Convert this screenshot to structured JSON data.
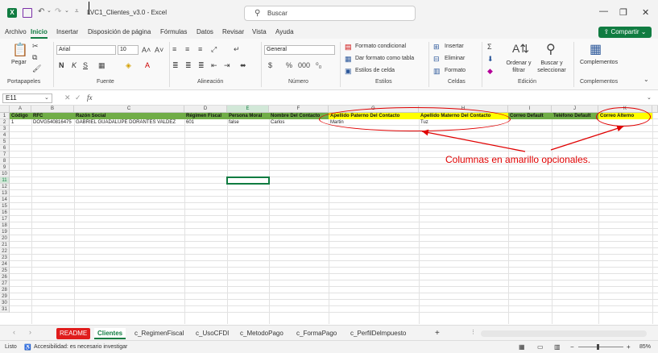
{
  "window": {
    "doc_title": "LVC1_Clientes_v3.0",
    "app": "Excel",
    "title_sep": " - "
  },
  "search": {
    "placeholder": "Buscar"
  },
  "menu": {
    "items": [
      "Archivo",
      "Inicio",
      "Insertar",
      "Disposición de página",
      "Fórmulas",
      "Datos",
      "Revisar",
      "Vista",
      "Ayuda"
    ],
    "active": "Inicio",
    "share_label": "Compartir"
  },
  "ribbon": {
    "clipboard": {
      "paste": "Pegar",
      "label": "Portapapeles"
    },
    "font": {
      "name": "Arial",
      "size": "10",
      "bold": "N",
      "italic": "K",
      "underline": "S",
      "label": "Fuente"
    },
    "alignment": {
      "label": "Alineación"
    },
    "number": {
      "format": "General",
      "label": "Número"
    },
    "styles": {
      "conditional": "Formato condicional",
      "table": "Dar formato como tabla",
      "cell_styles": "Estilos de celda",
      "label": "Estilos"
    },
    "cells": {
      "insert": "Insertar",
      "delete": "Eliminar",
      "format": "Formato",
      "label": "Celdas"
    },
    "editing": {
      "sort": "Ordenar y filtrar",
      "find": "Buscar y seleccionar",
      "label": "Edición"
    },
    "addins": {
      "button": "Complementos",
      "label": "Complementos"
    }
  },
  "formula_bar": {
    "name_box": "E11",
    "fx": "fx",
    "formula": ""
  },
  "sheet": {
    "columns": [
      "A",
      "B",
      "C",
      "D",
      "E",
      "F",
      "G",
      "H",
      "I",
      "J",
      "K"
    ],
    "rows": 31,
    "headers": [
      "Código",
      "RFC",
      "Razón Social",
      "Régimen Fiscal",
      "Persona Moral",
      "Nombre Del Contacto",
      "Apellido Paterno Del Contacto",
      "Apellido Materno Del Contacto",
      "Correo Default",
      "Teléfono Default",
      "Correo Alterno"
    ],
    "data_row": [
      "1",
      "DOVG540816475",
      "GABRIEL GUADALUPE  DORANTES  VALDEZ",
      "601",
      "false",
      "Carlos",
      "Martin",
      "Tuz",
      "",
      "",
      ""
    ],
    "yellow_columns": [
      6,
      7,
      10
    ],
    "selected_cell": "E11",
    "colors": {
      "header_green": "#70ad47",
      "header_yellow": "#ffff00",
      "annotation_red": "#e00000"
    }
  },
  "annotation": "Columnas en amarillo opcionales.",
  "tabs": [
    "README",
    "Clientes",
    "c_RegimenFiscal",
    "c_UsoCFDI",
    "c_MetodoPago",
    "c_FormaPago",
    "c_PerfilDelmpuesto"
  ],
  "active_tab": "Clientes",
  "add_sheet": "+",
  "status": {
    "ready": "Listo",
    "accessibility": "Accesibilidad: es necesario investigar",
    "zoom": "85%"
  }
}
